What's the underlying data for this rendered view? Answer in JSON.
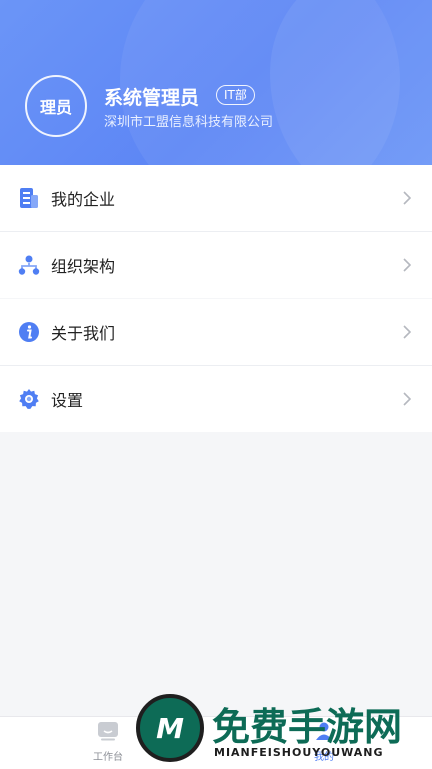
{
  "profile": {
    "avatar_text": "理员",
    "name": "系统管理员",
    "dept_badge": "IT部",
    "company": "深圳市工盟信息科技有限公司"
  },
  "menu_group1": [
    {
      "label": "我的企业",
      "icon": "building-icon"
    },
    {
      "label": "组织架构",
      "icon": "org-chart-icon"
    }
  ],
  "menu_group2": [
    {
      "label": "关于我们",
      "icon": "info-icon"
    },
    {
      "label": "设置",
      "icon": "gear-icon"
    }
  ],
  "tabbar": {
    "workbench_label": "工作台",
    "mine_label": "我的"
  },
  "watermark": {
    "logo_letter": "M",
    "title": "免费手游网",
    "subtitle": "MIANFEISHOUYOUWANG"
  },
  "colors": {
    "header_blue": "#6b95f7",
    "icon_blue": "#4f7ef3",
    "watermark_green": "#0d6b56"
  }
}
